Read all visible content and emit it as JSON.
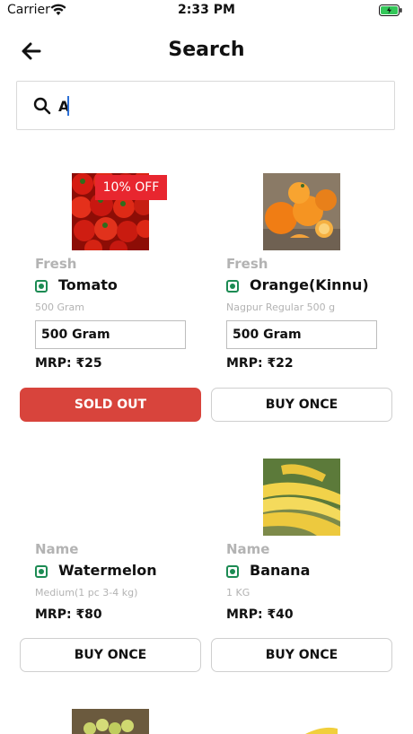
{
  "status_bar": {
    "carrier": "Carrier",
    "time": "2:33 PM"
  },
  "header": {
    "title": "Search"
  },
  "search": {
    "value": "A"
  },
  "colors": {
    "sold_out": "#d8443c",
    "discount_badge": "#e8262f",
    "veg_mark": "#1c8b53"
  },
  "products": [
    {
      "category": "Fresh",
      "name": "Tomato",
      "variant": "500 Gram",
      "selected_option": "500 Gram",
      "mrp": "MRP: ₹25",
      "badge": "10% OFF",
      "button": "SOLD OUT",
      "image": "tomato-image"
    },
    {
      "category": "Fresh",
      "name": "Orange(Kinnu)",
      "variant": "Nagpur Regular 500 g",
      "selected_option": "500 Gram",
      "mrp": "MRP: ₹22",
      "button": "BUY ONCE",
      "image": "orange-image"
    },
    {
      "category": "Name",
      "name": "Watermelon",
      "variant": "Medium(1 pc 3-4 kg)",
      "mrp": "MRP: ₹80",
      "button": "BUY ONCE"
    },
    {
      "category": "Name",
      "name": "Banana",
      "variant": "1 KG",
      "mrp": "MRP: ₹40",
      "button": "BUY ONCE",
      "image": "banana-image"
    }
  ]
}
